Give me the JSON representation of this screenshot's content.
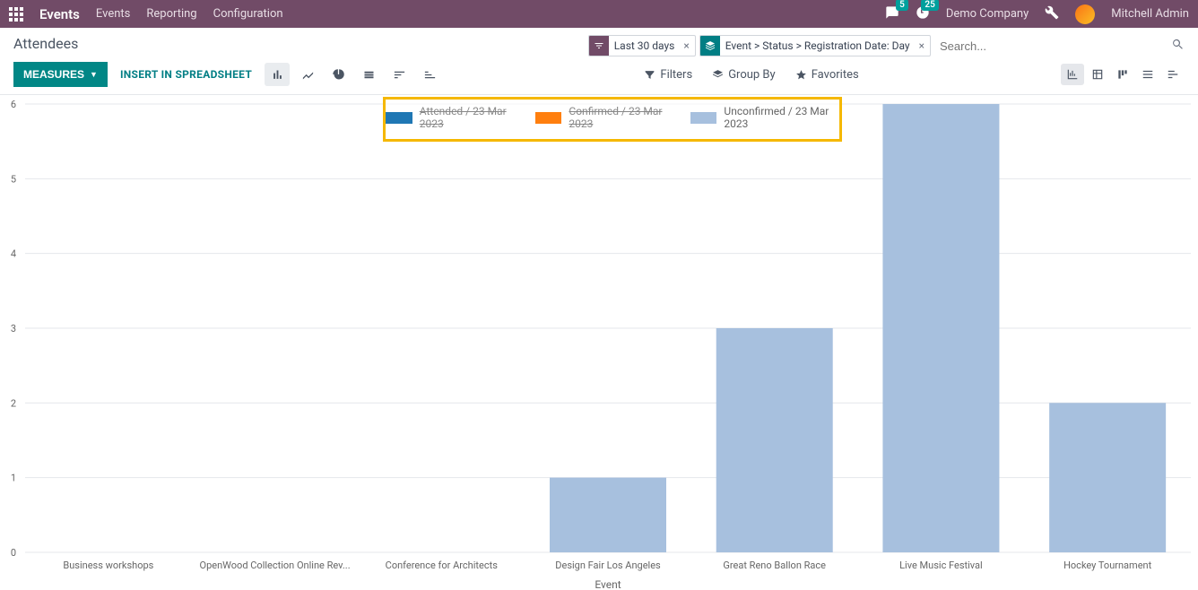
{
  "topnav": {
    "brand": "Events",
    "menus": [
      "Events",
      "Reporting",
      "Configuration"
    ],
    "chat_badge": "5",
    "clock_badge": "25",
    "company": "Demo Company",
    "user": "Mitchell Admin"
  },
  "header": {
    "title": "Attendees",
    "facets": {
      "filter": "Last 30 days",
      "group": "Event > Status > Registration Date: Day"
    },
    "search_placeholder": "Search..."
  },
  "toolbar": {
    "measures": "MEASURES",
    "insert": "INSERT IN SPREADSHEET",
    "filters": "Filters",
    "groupby": "Group By",
    "favorites": "Favorites"
  },
  "legend": {
    "attended": "Attended / 23 Mar 2023",
    "confirmed": "Confirmed / 23 Mar 2023",
    "unconfirmed": "Unconfirmed / 23 Mar 2023",
    "colors": {
      "attended": "#1F77B4",
      "confirmed": "#FF7F0E",
      "unconfirmed": "#A7C0DE"
    }
  },
  "chart_data": {
    "type": "bar",
    "title": "",
    "xlabel": "Event",
    "ylabel": "",
    "ylim": [
      0,
      6
    ],
    "yticks": [
      0,
      1,
      2,
      3,
      4,
      5,
      6
    ],
    "categories": [
      "Business workshops",
      "OpenWood Collection Online Rev...",
      "Conference for Architects",
      "Design Fair Los Angeles",
      "Great Reno Ballon Race",
      "Live Music Festival",
      "Hockey Tournament"
    ],
    "series": [
      {
        "name": "Attended / 23 Mar 2023",
        "visible": false,
        "color": "#1F77B4",
        "values": [
          0,
          0,
          0,
          0,
          0,
          0,
          0
        ]
      },
      {
        "name": "Confirmed / 23 Mar 2023",
        "visible": false,
        "color": "#FF7F0E",
        "values": [
          0,
          0,
          0,
          0,
          0,
          0,
          0
        ]
      },
      {
        "name": "Unconfirmed / 23 Mar 2023",
        "visible": true,
        "color": "#A7C0DE",
        "values": [
          0,
          0,
          0,
          1,
          3,
          6,
          2
        ]
      }
    ]
  }
}
